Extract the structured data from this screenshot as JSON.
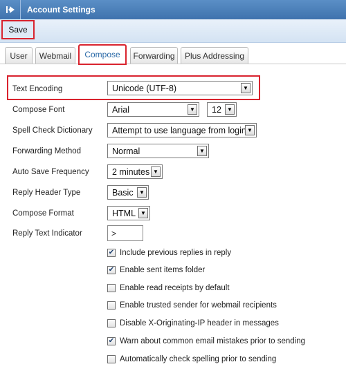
{
  "header": {
    "title": "Account Settings",
    "back_icon": "collapse-left-icon"
  },
  "toolbar": {
    "save_label": "Save"
  },
  "tabs": [
    {
      "label": "User",
      "active": false
    },
    {
      "label": "Webmail",
      "active": false
    },
    {
      "label": "Compose",
      "active": true
    },
    {
      "label": "Forwarding",
      "active": false
    },
    {
      "label": "Plus Addressing",
      "active": false
    }
  ],
  "settings": {
    "text_encoding": {
      "label": "Text Encoding",
      "value": "Unicode (UTF-8)"
    },
    "compose_font": {
      "label": "Compose Font",
      "value": "Arial",
      "size": "12"
    },
    "spell_check": {
      "label": "Spell Check Dictionary",
      "value": "Attempt to use language from login"
    },
    "forwarding_method": {
      "label": "Forwarding Method",
      "value": "Normal"
    },
    "auto_save": {
      "label": "Auto Save Frequency",
      "value": "2 minutes"
    },
    "reply_header": {
      "label": "Reply Header Type",
      "value": "Basic"
    },
    "compose_format": {
      "label": "Compose Format",
      "value": "HTML"
    },
    "reply_indicator": {
      "label": "Reply Text Indicator",
      "value": ">"
    }
  },
  "checkboxes": [
    {
      "label": "Include previous replies in reply",
      "checked": true
    },
    {
      "label": "Enable sent items folder",
      "checked": true
    },
    {
      "label": "Enable read receipts by default",
      "checked": false
    },
    {
      "label": "Enable trusted sender for webmail recipients",
      "checked": false
    },
    {
      "label": "Disable X-Originating-IP header in messages",
      "checked": false
    },
    {
      "label": "Warn about common email mistakes prior to sending",
      "checked": true
    },
    {
      "label": "Automatically check spelling prior to sending",
      "checked": false
    }
  ],
  "colors": {
    "header": "#4a7fb9",
    "highlight": "#d9232e",
    "active_tab_text": "#2b6aa8"
  }
}
